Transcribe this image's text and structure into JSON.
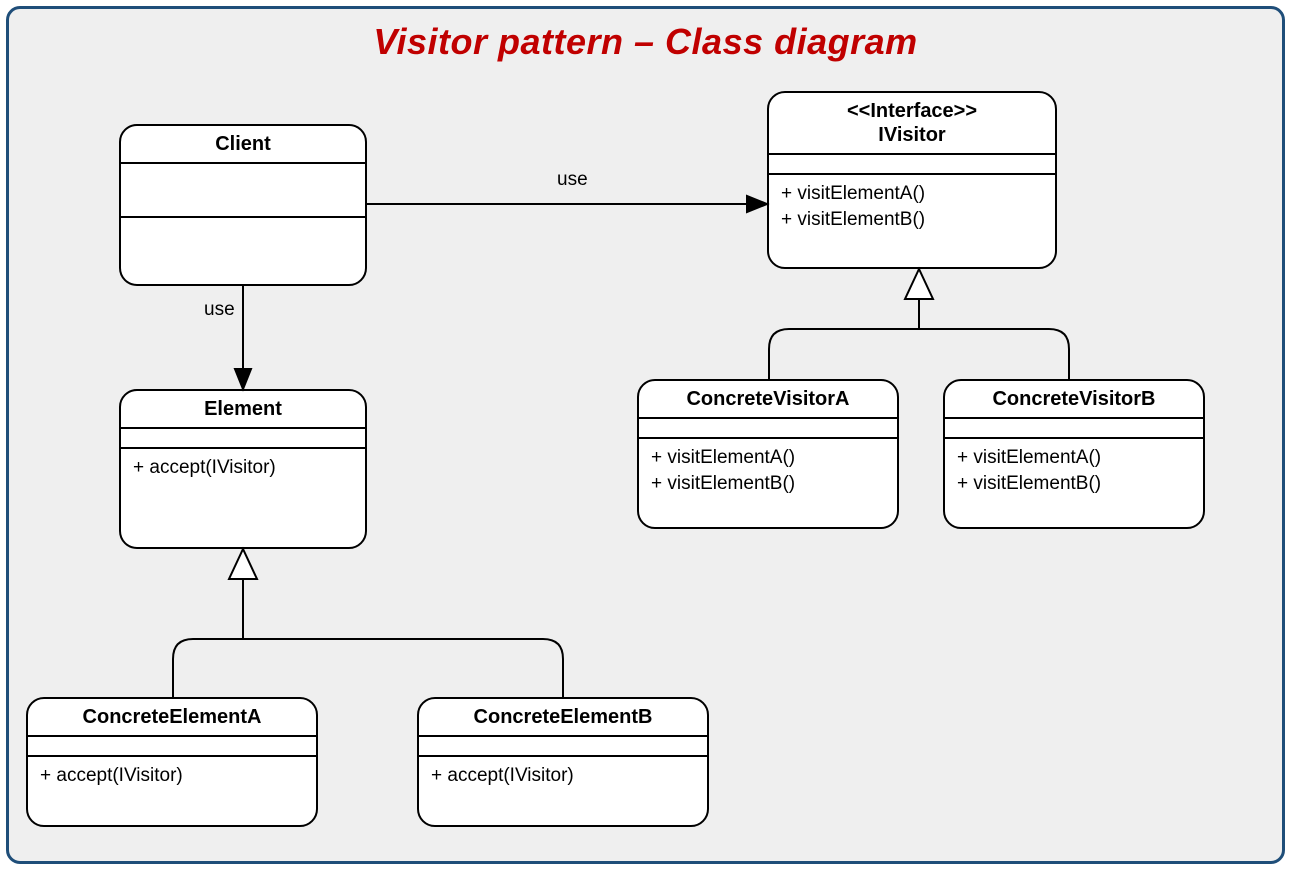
{
  "title": "Visitor pattern – Class diagram",
  "labels": {
    "clientToVisitor": "use",
    "clientToElement": "use"
  },
  "boxes": {
    "client": {
      "name": "Client",
      "attributes": [],
      "operations": []
    },
    "ivisitor": {
      "stereotype": "<<Interface>>",
      "name": "IVisitor",
      "attributes": [],
      "operations": [
        "+ visitElementA()",
        "+ visitElementB()"
      ]
    },
    "element": {
      "name": "Element",
      "attributes": [],
      "operations": [
        "+ accept(IVisitor)"
      ]
    },
    "concreteVisitorA": {
      "name": "ConcreteVisitorA",
      "attributes": [],
      "operations": [
        "+ visitElementA()",
        "+ visitElementB()"
      ]
    },
    "concreteVisitorB": {
      "name": "ConcreteVisitorB",
      "attributes": [],
      "operations": [
        "+ visitElementA()",
        "+ visitElementB()"
      ]
    },
    "concreteElementA": {
      "name": "ConcreteElementA",
      "attributes": [],
      "operations": [
        "+ accept(IVisitor)"
      ]
    },
    "concreteElementB": {
      "name": "ConcreteElementB",
      "attributes": [],
      "operations": [
        "+ accept(IVisitor)"
      ]
    }
  },
  "relationships": [
    {
      "from": "Client",
      "to": "IVisitor",
      "type": "dependency",
      "label": "use"
    },
    {
      "from": "Client",
      "to": "Element",
      "type": "dependency",
      "label": "use"
    },
    {
      "from": "ConcreteVisitorA",
      "to": "IVisitor",
      "type": "realization"
    },
    {
      "from": "ConcreteVisitorB",
      "to": "IVisitor",
      "type": "realization"
    },
    {
      "from": "ConcreteElementA",
      "to": "Element",
      "type": "generalization"
    },
    {
      "from": "ConcreteElementB",
      "to": "Element",
      "type": "generalization"
    }
  ]
}
